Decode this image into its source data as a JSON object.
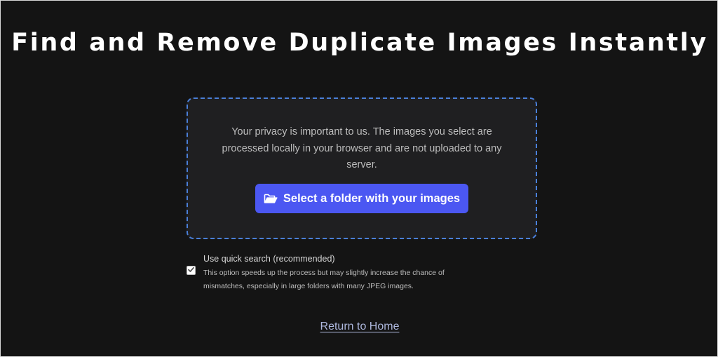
{
  "page": {
    "title": "Find and Remove Duplicate Images Instantly"
  },
  "dropzone": {
    "privacy_text": "Your privacy is important to us. The images you select are processed locally in your browser and are not uploaded to any server.",
    "select_button_label": "Select a folder with your images",
    "select_button_icon": "folder-open-icon"
  },
  "quick_search": {
    "label": "Use quick search (recommended)",
    "checked": true,
    "description": "This option speeds up the process but may slightly increase the chance of mismatches, especially in large folders with many JPEG images."
  },
  "footer": {
    "return_link": "Return to Home"
  },
  "colors": {
    "background": "#141414",
    "panel": "#1f1f21",
    "dashed_border": "#4a7fd8",
    "accent_button": "#4b57f2",
    "link": "#aeb8de"
  }
}
